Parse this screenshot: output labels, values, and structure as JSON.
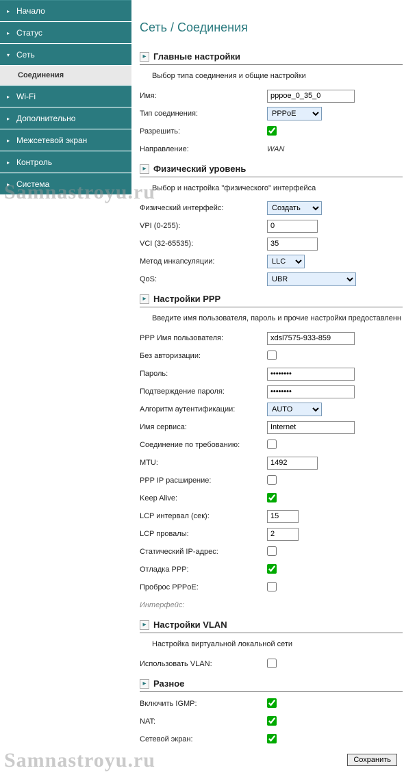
{
  "sidebar": {
    "items": [
      {
        "label": "Начало"
      },
      {
        "label": "Статус"
      },
      {
        "label": "Сеть",
        "expanded": true,
        "sub": [
          {
            "label": "Соединения",
            "active": true
          }
        ]
      },
      {
        "label": "Wi-Fi"
      },
      {
        "label": "Дополнительно"
      },
      {
        "label": "Межсетевой экран"
      },
      {
        "label": "Контроль"
      },
      {
        "label": "Система"
      }
    ]
  },
  "page": {
    "title": "Сеть / Соединения"
  },
  "sections": {
    "main": {
      "title": "Главные настройки",
      "desc": "Выбор типа соединения и общие настройки"
    },
    "phy": {
      "title": "Физический уровень",
      "desc": "Выбор и настройка \"физического\" интерфейса"
    },
    "ppp": {
      "title": "Настройки PPP",
      "desc": "Введите имя пользователя, пароль и прочие настройки предоставленн"
    },
    "vlan": {
      "title": "Настройки VLAN",
      "desc": "Настройка виртуальной локальной сети"
    },
    "misc": {
      "title": "Разное"
    }
  },
  "main": {
    "name_label": "Имя:",
    "name_value": "pppoe_0_35_0",
    "conn_type_label": "Тип соединения:",
    "conn_type_value": "PPPoE",
    "allow_label": "Разрешить:",
    "allow_checked": true,
    "direction_label": "Направление:",
    "direction_value": "WAN"
  },
  "phy": {
    "iface_label": "Физический интерфейс:",
    "iface_value": "Создать",
    "vpi_label": "VPI (0-255):",
    "vpi_value": "0",
    "vci_label": "VCI (32-65535):",
    "vci_value": "35",
    "encap_label": "Метод инкапсуляции:",
    "encap_value": "LLC",
    "qos_label": "QoS:",
    "qos_value": "UBR"
  },
  "ppp": {
    "user_label": "PPP Имя пользователя:",
    "user_value": "xdsl7575-933-859",
    "noauth_label": "Без авторизации:",
    "noauth_checked": false,
    "pass_label": "Пароль:",
    "pass_value": "••••••••",
    "pass2_label": "Подтверждение пароля:",
    "pass2_value": "••••••••",
    "auth_label": "Алгоритм аутентификации:",
    "auth_value": "AUTO",
    "service_label": "Имя сервиса:",
    "service_value": "Internet",
    "dial_label": "Соединение по требованию:",
    "dial_checked": false,
    "mtu_label": "MTU:",
    "mtu_value": "1492",
    "ipext_label": "PPP IP расширение:",
    "ipext_checked": false,
    "keep_label": "Keep Alive:",
    "keep_checked": true,
    "lcpint_label": "LCP интервал (сек):",
    "lcpint_value": "15",
    "lcpfail_label": "LCP провалы:",
    "lcpfail_value": "2",
    "static_label": "Статический IP-адрес:",
    "static_checked": false,
    "debug_label": "Отладка PPP:",
    "debug_checked": true,
    "passthru_label": "Проброс PPPoE:",
    "passthru_checked": false,
    "iface_label": "Интерфейс:"
  },
  "vlan": {
    "use_label": "Использовать VLAN:",
    "use_checked": false
  },
  "misc": {
    "igmp_label": "Включить IGMP:",
    "igmp_checked": true,
    "nat_label": "NAT:",
    "nat_checked": true,
    "fw_label": "Сетевой экран:",
    "fw_checked": true
  },
  "buttons": {
    "save": "Сохранить"
  },
  "watermark": "Samnastroyu.ru"
}
